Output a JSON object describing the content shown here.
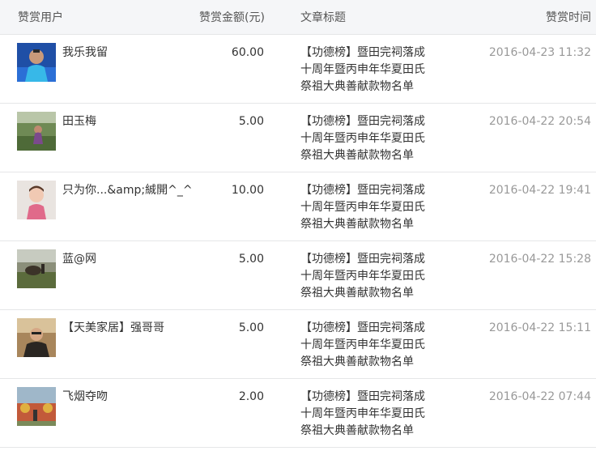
{
  "header": {
    "user": "赞赏用户",
    "amount": "赞赏金额(元)",
    "title": "文章标题",
    "time": "赞赏时间"
  },
  "rows": [
    {
      "user": "我乐我留",
      "amount": "60.00",
      "title_lines": [
        "【功德榜】暨田完祠落成",
        "十周年暨丙申年华夏田氏",
        "祭祖大典善献款物名单"
      ],
      "time": "2016-04-23 11:32"
    },
    {
      "user": "田玉梅",
      "amount": "5.00",
      "title_lines": [
        "【功德榜】暨田完祠落成",
        "十周年暨丙申年华夏田氏",
        "祭祖大典善献款物名单"
      ],
      "time": "2016-04-22 20:54"
    },
    {
      "user": "只为你...&amp;絾開^_^",
      "amount": "10.00",
      "title_lines": [
        "【功德榜】暨田完祠落成",
        "十周年暨丙申年华夏田氏",
        "祭祖大典善献款物名单"
      ],
      "time": "2016-04-22 19:41"
    },
    {
      "user": "蓝@网",
      "amount": "5.00",
      "title_lines": [
        "【功德榜】暨田完祠落成",
        "十周年暨丙申年华夏田氏",
        "祭祖大典善献款物名单"
      ],
      "time": "2016-04-22 15:28"
    },
    {
      "user": "【天美家居】强哥哥",
      "amount": "5.00",
      "title_lines": [
        "【功德榜】暨田完祠落成",
        "十周年暨丙申年华夏田氏",
        "祭祖大典善献款物名单"
      ],
      "time": "2016-04-22 15:11"
    },
    {
      "user": "飞烟夺吻",
      "amount": "2.00",
      "title_lines": [
        "【功德榜】暨田完祠落成",
        "十周年暨丙申年华夏田氏",
        "祭祖大典善献款物名单"
      ],
      "time": "2016-04-22 07:44"
    }
  ]
}
